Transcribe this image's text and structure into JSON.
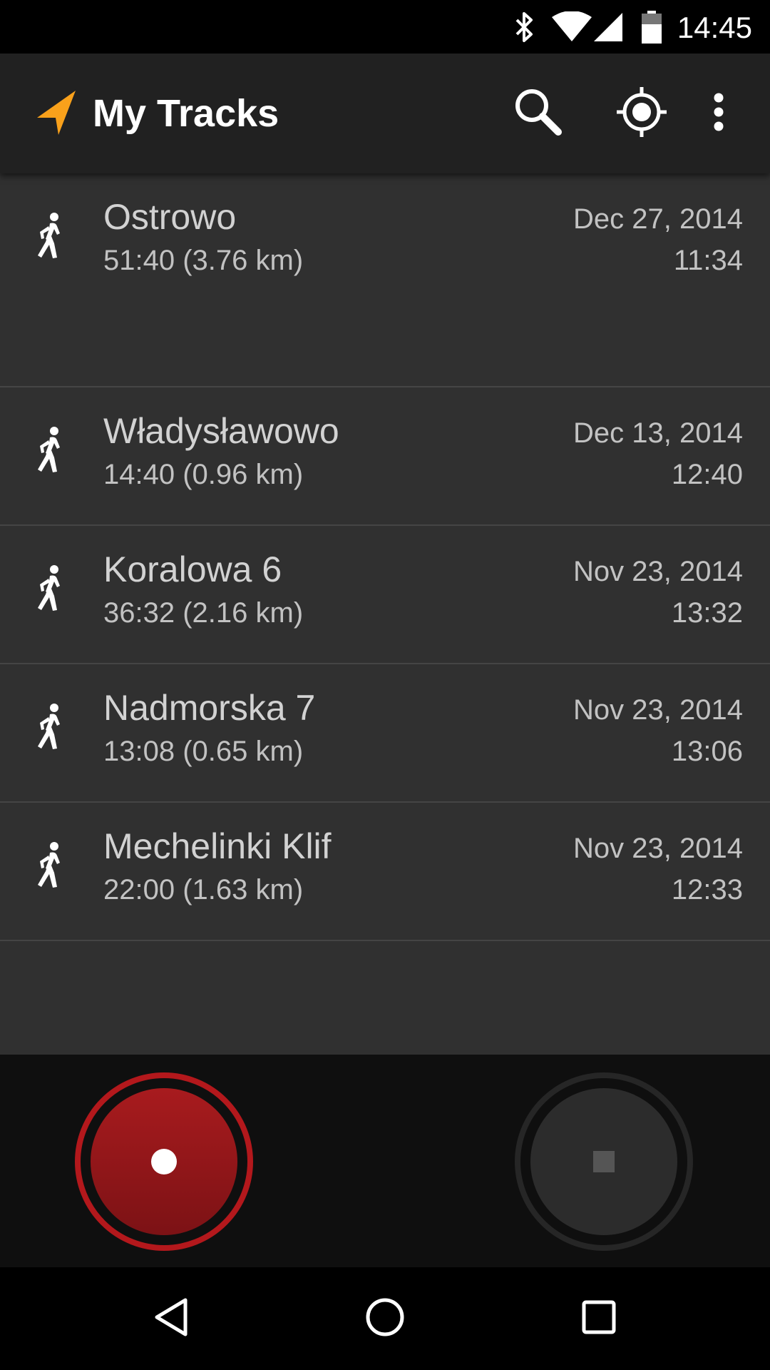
{
  "status_bar": {
    "time": "14:45",
    "icons": [
      "bluetooth-icon",
      "wifi-icon",
      "cell-signal-icon",
      "battery-icon"
    ]
  },
  "app_bar": {
    "title": "My Tracks",
    "logo_icon": "navigation-arrow-icon",
    "accent_color": "#f9a11b",
    "actions": [
      "search-icon",
      "my-location-icon",
      "more-vert-icon"
    ]
  },
  "tracks": [
    {
      "name": "Ostrowo",
      "detail": "51:40 (3.76 km)",
      "date": "Dec 27, 2014",
      "time": "11:34",
      "icon": "walk-icon"
    },
    {
      "name": "Władysławowo",
      "detail": "14:40 (0.96 km)",
      "date": "Dec 13, 2014",
      "time": "12:40",
      "icon": "walk-icon"
    },
    {
      "name": "Koralowa 6",
      "detail": "36:32 (2.16 km)",
      "date": "Nov 23, 2014",
      "time": "13:32",
      "icon": "walk-icon"
    },
    {
      "name": "Nadmorska 7",
      "detail": "13:08 (0.65 km)",
      "date": "Nov 23, 2014",
      "time": "13:06",
      "icon": "walk-icon"
    },
    {
      "name": "Mechelinki Klif",
      "detail": "22:00 (1.63 km)",
      "date": "Nov 23, 2014",
      "time": "12:33",
      "icon": "walk-icon"
    }
  ],
  "controls": {
    "record_icon": "record-icon",
    "stop_icon": "stop-icon",
    "record_color": "#b3181c"
  },
  "nav_bar": {
    "buttons": [
      "back-icon",
      "home-icon",
      "recents-icon"
    ]
  }
}
